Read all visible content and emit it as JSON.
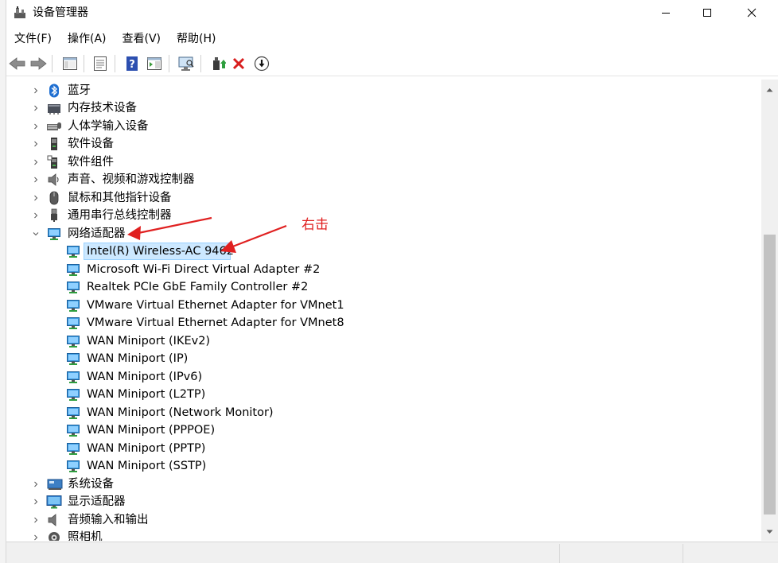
{
  "window": {
    "title": "设备管理器"
  },
  "menu": {
    "items": [
      "文件(F)",
      "操作(A)",
      "查看(V)",
      "帮助(H)"
    ]
  },
  "toolbar": {
    "icons": [
      "back-arrow-icon",
      "forward-arrow-icon",
      "show-hide-tree-icon",
      "properties-icon",
      "help-icon",
      "action-pane-icon",
      "scan-hardware-icon",
      "update-driver-icon",
      "uninstall-icon",
      "disable-icon"
    ]
  },
  "tree": {
    "categories_top": [
      {
        "label": "蓝牙",
        "icon": "bluetooth-icon",
        "expanded": false
      },
      {
        "label": "内存技术设备",
        "icon": "memory-icon",
        "expanded": false
      },
      {
        "label": "人体学输入设备",
        "icon": "keyboard-icon",
        "expanded": false
      },
      {
        "label": "软件设备",
        "icon": "software-device-icon",
        "expanded": false
      },
      {
        "label": "软件组件",
        "icon": "software-component-icon",
        "expanded": false
      },
      {
        "label": "声音、视频和游戏控制器",
        "icon": "speaker-icon",
        "expanded": false
      },
      {
        "label": "鼠标和其他指针设备",
        "icon": "mouse-icon",
        "expanded": false
      },
      {
        "label": "通用串行总线控制器",
        "icon": "usb-icon",
        "expanded": false
      }
    ],
    "network": {
      "label": "网络适配器",
      "icon": "network-adapter-icon",
      "expanded": true,
      "children": [
        "Intel(R) Wireless-AC 9462",
        "Microsoft Wi-Fi Direct Virtual Adapter #2",
        "Realtek PCIe GbE Family Controller #2",
        "VMware Virtual Ethernet Adapter for VMnet1",
        "VMware Virtual Ethernet Adapter for VMnet8",
        "WAN Miniport (IKEv2)",
        "WAN Miniport (IP)",
        "WAN Miniport (IPv6)",
        "WAN Miniport (L2TP)",
        "WAN Miniport (Network Monitor)",
        "WAN Miniport (PPPOE)",
        "WAN Miniport (PPTP)",
        "WAN Miniport (SSTP)"
      ],
      "selected_index": 0
    },
    "categories_bottom": [
      {
        "label": "系统设备",
        "icon": "system-device-icon",
        "expanded": false
      },
      {
        "label": "显示适配器",
        "icon": "display-adapter-icon",
        "expanded": false
      },
      {
        "label": "音频输入和输出",
        "icon": "audio-io-icon",
        "expanded": false
      },
      {
        "label": "照相机",
        "icon": "camera-icon",
        "expanded": false
      }
    ]
  },
  "annotation": {
    "text": "右击",
    "color": "#e02020"
  },
  "colors": {
    "selection": "#cce8ff",
    "adapter_icon": "#2a8fd6",
    "annotation": "#e02020"
  }
}
